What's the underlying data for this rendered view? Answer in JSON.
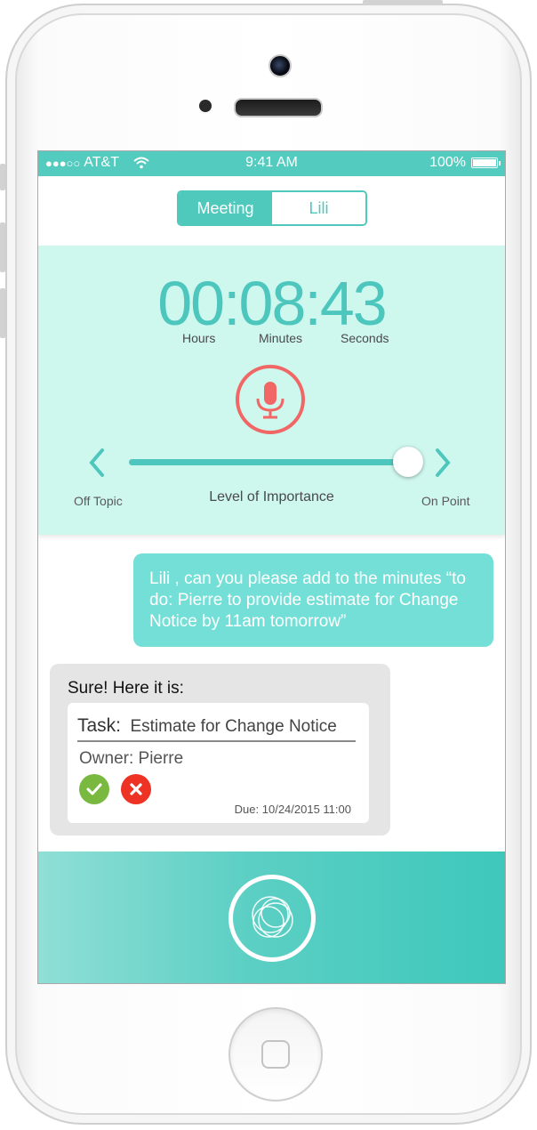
{
  "status_bar": {
    "signal_dots": "●●●○○",
    "carrier": "AT&T",
    "time": "9:41 AM",
    "battery_percent": "100%",
    "wifi_icon": "wifi-icon",
    "battery_icon": "battery-icon"
  },
  "segment": {
    "tabs": [
      {
        "label": "Meeting",
        "selected": true
      },
      {
        "label": "Lili",
        "selected": false
      }
    ]
  },
  "timer": {
    "display": "00:08:43",
    "units": [
      "Hours",
      "Minutes",
      "Seconds"
    ]
  },
  "importance": {
    "title": "Level of Importance",
    "min_label": "Off Topic",
    "max_label": "On Point",
    "value": 1.0
  },
  "chat": {
    "user_message": "Lili , can you please add to the minutes “to do: Pierre to provide estimate for Change Notice by 11am tomorrow”",
    "bot_message": "Sure! Here it is:",
    "task_card": {
      "task_label": "Task:",
      "task_value": "Estimate for Change Notice",
      "owner": "Owner: Pierre",
      "due": "Due: 10/24/2015 11:00"
    }
  },
  "colors": {
    "accent": "#4fc9bc",
    "panel": "#cef7ee",
    "record": "#f06765",
    "accept": "#7ab93f",
    "reject": "#ee3324",
    "user_bubble": "#74dfd7",
    "bot_bubble": "#e5e5e5"
  },
  "icons": {
    "mic": "microphone-icon",
    "prev": "chevron-left-icon",
    "next": "chevron-right-icon",
    "accept": "checkmark-icon",
    "reject": "close-icon",
    "assistant": "assistant-orb-icon"
  }
}
